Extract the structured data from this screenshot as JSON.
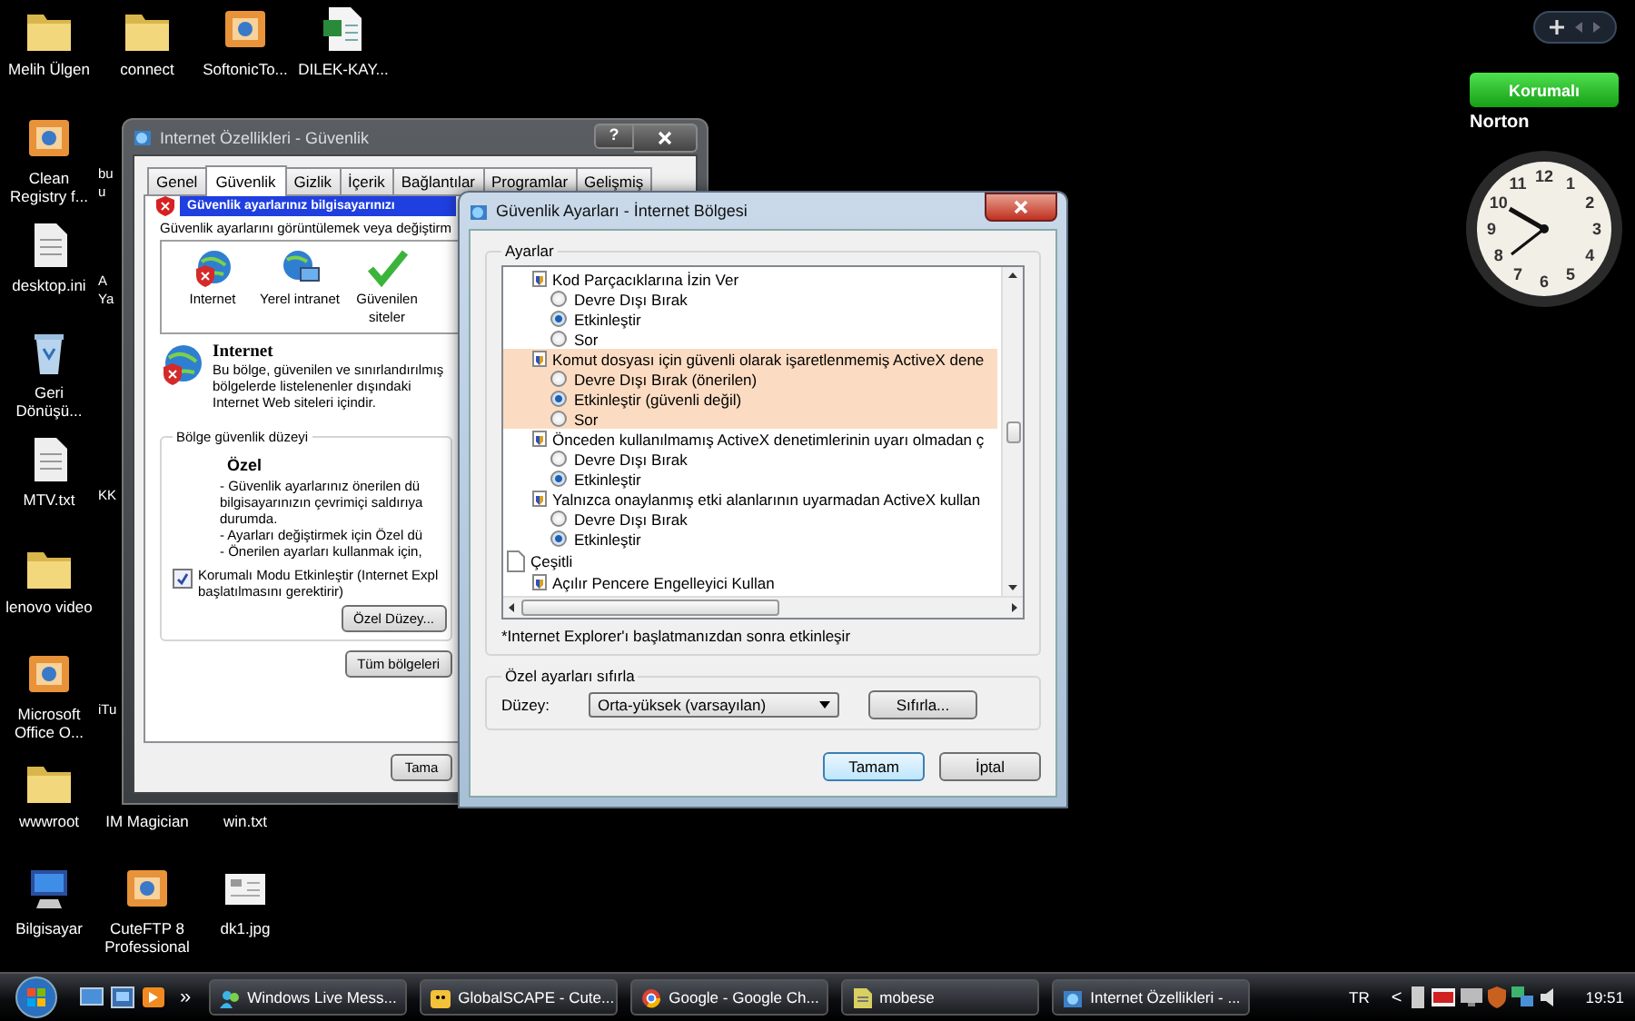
{
  "desktop_icons": [
    {
      "label": "Melih Ülgen",
      "kind": "folder"
    },
    {
      "label": "connect",
      "kind": "folder"
    },
    {
      "label": "SoftonicTo...",
      "kind": "app"
    },
    {
      "label": "DILEK-KAY...",
      "kind": "excel"
    },
    {
      "label": "Clean Registry f...",
      "kind": "app"
    },
    {
      "label": "desktop.ini",
      "kind": "doc"
    },
    {
      "label": "Geri Dönüşü...",
      "kind": "recycle"
    },
    {
      "label": "MTV.txt",
      "kind": "doc"
    },
    {
      "label": "lenovo video",
      "kind": "folder"
    },
    {
      "label": "Microsoft Office O...",
      "kind": "app"
    },
    {
      "label": "wwwroot",
      "kind": "folder"
    },
    {
      "label": "Bilgisayar",
      "kind": "computer"
    },
    {
      "label": "IM Magician",
      "kind": "covered"
    },
    {
      "label": "CuteFTP 8 Professional",
      "kind": "app"
    },
    {
      "label": "win.txt",
      "kind": "covered"
    },
    {
      "label": "dk1.jpg",
      "kind": "image"
    }
  ],
  "partial_labels": [
    {
      "lines": [
        "bu",
        "u"
      ]
    },
    {
      "lines": [
        "A",
        "Ya"
      ]
    },
    {
      "lines": [
        "KK"
      ]
    },
    {
      "lines": [
        "iTu"
      ]
    }
  ],
  "internet_options": {
    "title": "Internet Özellikleri - Güvenlik",
    "help_button": "?",
    "tabs": [
      {
        "label": "Genel",
        "selected": false
      },
      {
        "label": "Güvenlik",
        "selected": true
      },
      {
        "label": "Gizlik",
        "selected": false
      },
      {
        "label": "İçerik",
        "selected": false
      },
      {
        "label": "Bağlantılar",
        "selected": false
      },
      {
        "label": "Programlar",
        "selected": false
      },
      {
        "label": "Gelişmiş",
        "selected": false
      }
    ],
    "banner": "Güvenlik ayarlarınız bilgisayarınızı",
    "zone_prompt": "Güvenlik ayarlarını görüntülemek veya değiştirm",
    "zones": [
      {
        "label": "Internet",
        "kind": "internet"
      },
      {
        "label": "Yerel intranet",
        "kind": "intranet"
      },
      {
        "label": "Güvenilen siteler",
        "kind": "trusted"
      }
    ],
    "zone_title": "Internet",
    "zone_description": "Bu bölge, güvenilen ve sınırlandırılmış bölgelerde listelenenler dışındaki Internet Web siteleri içindir.",
    "level_group": "Bölge güvenlik düzeyi",
    "level_name": "Özel",
    "level_lines": [
      "- Güvenlik ayarlarınız önerilen dü",
      "bilgisayarınızın çevrimiçi saldırıya",
      "durumda.",
      "- Ayarları değiştirmek için Özel dü",
      "- Önerilen ayarları kullanmak için,"
    ],
    "protected_mode": {
      "lines": [
        "Korumalı Modu Etkinleştir (Internet Expl",
        "başlatılmasını gerektirir)"
      ],
      "checked": true
    },
    "custom_level_button": "Özel Düzey...",
    "all_zones_button": "Tüm bölgeleri",
    "ok_button": "Tama"
  },
  "security_settings": {
    "title": "Güvenlik Ayarları - İnternet Bölgesi",
    "settings_group": "Ayarlar",
    "settings": [
      {
        "kind": "setting",
        "label": "Kod Parçacıklarına İzin Ver",
        "highlighted": false,
        "options": [
          {
            "label": "Devre Dışı Bırak",
            "selected": false
          },
          {
            "label": "Etkinleştir",
            "selected": true
          },
          {
            "label": "Sor",
            "selected": false
          }
        ]
      },
      {
        "kind": "setting",
        "label": "Komut dosyası için güvenli olarak işaretlenmemiş ActiveX dene",
        "highlighted": true,
        "options": [
          {
            "label": "Devre Dışı Bırak (önerilen)",
            "selected": false
          },
          {
            "label": "Etkinleştir (güvenli değil)",
            "selected": true
          },
          {
            "label": "Sor",
            "selected": false
          }
        ]
      },
      {
        "kind": "setting",
        "label": "Önceden kullanılmamış ActiveX denetimlerinin uyarı olmadan ç",
        "highlighted": false,
        "options": [
          {
            "label": "Devre Dışı Bırak",
            "selected": false
          },
          {
            "label": "Etkinleştir",
            "selected": true
          }
        ]
      },
      {
        "kind": "setting",
        "label": "Yalnızca onaylanmış etki alanlarının uyarmadan ActiveX kullan",
        "highlighted": false,
        "options": [
          {
            "label": "Devre Dışı Bırak",
            "selected": false
          },
          {
            "label": "Etkinleştir",
            "selected": true
          }
        ]
      },
      {
        "kind": "category",
        "label": "Çeşitli",
        "children": [
          {
            "kind": "setting",
            "label": "Açılır Pencere Engelleyici Kullan",
            "highlighted": false
          }
        ]
      }
    ],
    "note": "*Internet Explorer'ı başlatmanızdan sonra etkinleşir",
    "reset_group": "Özel ayarları sıfırla",
    "level_label": "Düzey:",
    "level_value": "Orta-yüksek (varsayılan)",
    "reset_button": "Sıfırla...",
    "ok_button": "Tamam",
    "cancel_button": "İptal"
  },
  "taskbar": {
    "more": "»",
    "tasks": [
      {
        "label": "Windows Live Mess...",
        "kind": "messenger"
      },
      {
        "label": "GlobalSCAPE - Cute...",
        "kind": "ftp"
      },
      {
        "label": "Google - Google Ch...",
        "kind": "browser"
      },
      {
        "label": "mobese",
        "kind": "file"
      },
      {
        "label": "Internet Özellikleri - ...",
        "kind": "settings"
      }
    ],
    "language": "TR",
    "tray_expand": "<",
    "clock": "19:51"
  },
  "gadgets": {
    "norton_status": "Korumalı",
    "norton_brand": "Norton",
    "clock_numerals": [
      "11",
      "12",
      "1",
      "10",
      "2",
      "9",
      "3",
      "8",
      "4",
      "7",
      "5",
      "6"
    ]
  }
}
